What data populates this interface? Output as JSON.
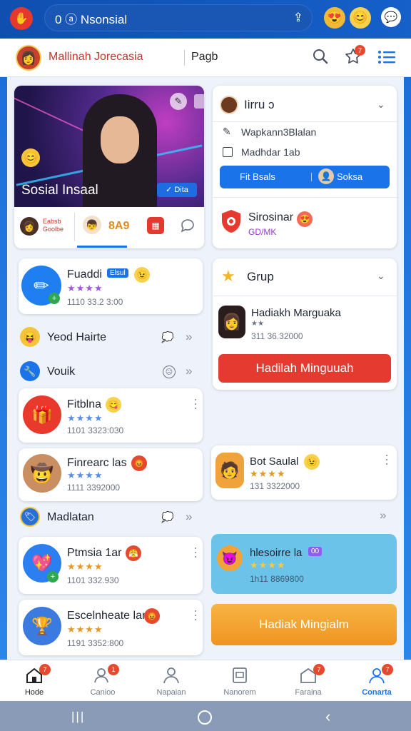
{
  "topbar": {
    "url_text": "0 ⓐ Nsonsial",
    "icons": [
      "app-logo-icon",
      "upload-icon",
      "face-emoji-icon",
      "smile-emoji-icon",
      "messenger-icon"
    ]
  },
  "header": {
    "brand": "Mallinah Jorecasia",
    "page_label": "Pagb",
    "notification_count": "7"
  },
  "hero": {
    "title": "Sosial Insaal",
    "button": "✓ Dita",
    "tabs": [
      {
        "label": "Eabsb\nGoolbe"
      },
      {
        "label": "8A9"
      }
    ]
  },
  "profile_card": {
    "title": "Iirru ɔ",
    "option1": "Wapkann3Blalan",
    "option2": "Madhdar 1ab",
    "btn_left": "Fit Bsals",
    "btn_right": "Soksa",
    "shield_title": "Sirosinar",
    "shield_sub": "GD/MK"
  },
  "group_card": {
    "title": "Grup",
    "person_name": "Hadiakh Marguaka",
    "person_meta": "311 36.32000",
    "cta": "Hadilah Minguuah"
  },
  "left_list": [
    {
      "title": "Fuaddi",
      "badge": "Elsul",
      "meta": "1110 33.2 3:00"
    },
    {
      "title": "Fitblna",
      "meta": "1101 3323:030"
    },
    {
      "title": "Finrearc las",
      "meta": "1111 3392000"
    },
    {
      "title": "Ptmsia 1ar",
      "meta": "1101 332.930"
    },
    {
      "title": "Escelnheate lan",
      "meta": "1191 3352:800"
    }
  ],
  "rows": [
    {
      "label": "Yeod Hairte"
    },
    {
      "label": "Vouik"
    },
    {
      "label": "Madlatan"
    }
  ],
  "right_list": [
    {
      "title": "Bot Saulal",
      "meta": "131 3322000"
    },
    {
      "title": "hlesoirre la",
      "badge": "00",
      "meta": "1h11 8869800"
    }
  ],
  "right_cta": "Hadiak Mingialm",
  "bottom_nav": [
    {
      "label": "Hode",
      "badge": "7"
    },
    {
      "label": "Canioo",
      "badge": "1"
    },
    {
      "label": "Napaian",
      "badge": ""
    },
    {
      "label": "Nanorem",
      "badge": ""
    },
    {
      "label": "Faraina",
      "badge": "7"
    },
    {
      "label": "Conarta",
      "badge": "7"
    }
  ],
  "colors": {
    "primary": "#1a73e8",
    "topbar": "#1560c9",
    "red_cta": "#e53a2f",
    "orange_cta": "#f5a623",
    "highlight_card": "#6cc3ea"
  }
}
